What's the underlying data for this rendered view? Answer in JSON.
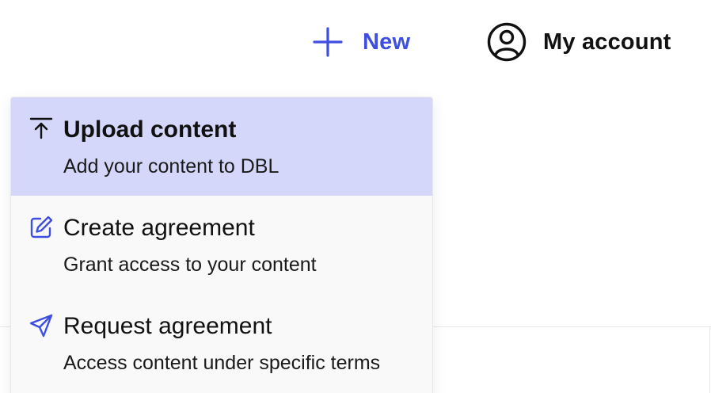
{
  "header": {
    "new_label": "New",
    "account_label": "My account"
  },
  "colors": {
    "accent": "#3d4ee0",
    "active_item_bg": "#d4d6fa",
    "menu_bg": "#f9f9f9",
    "text": "#111111"
  },
  "menu": {
    "items": [
      {
        "icon": "upload-icon",
        "title": "Upload content",
        "description": "Add your content to DBL",
        "active": true
      },
      {
        "icon": "edit-icon",
        "title": "Create agreement",
        "description": "Grant access to your content",
        "active": false
      },
      {
        "icon": "send-icon",
        "title": "Request agreement",
        "description": "Access content under specific terms",
        "active": false
      }
    ]
  }
}
